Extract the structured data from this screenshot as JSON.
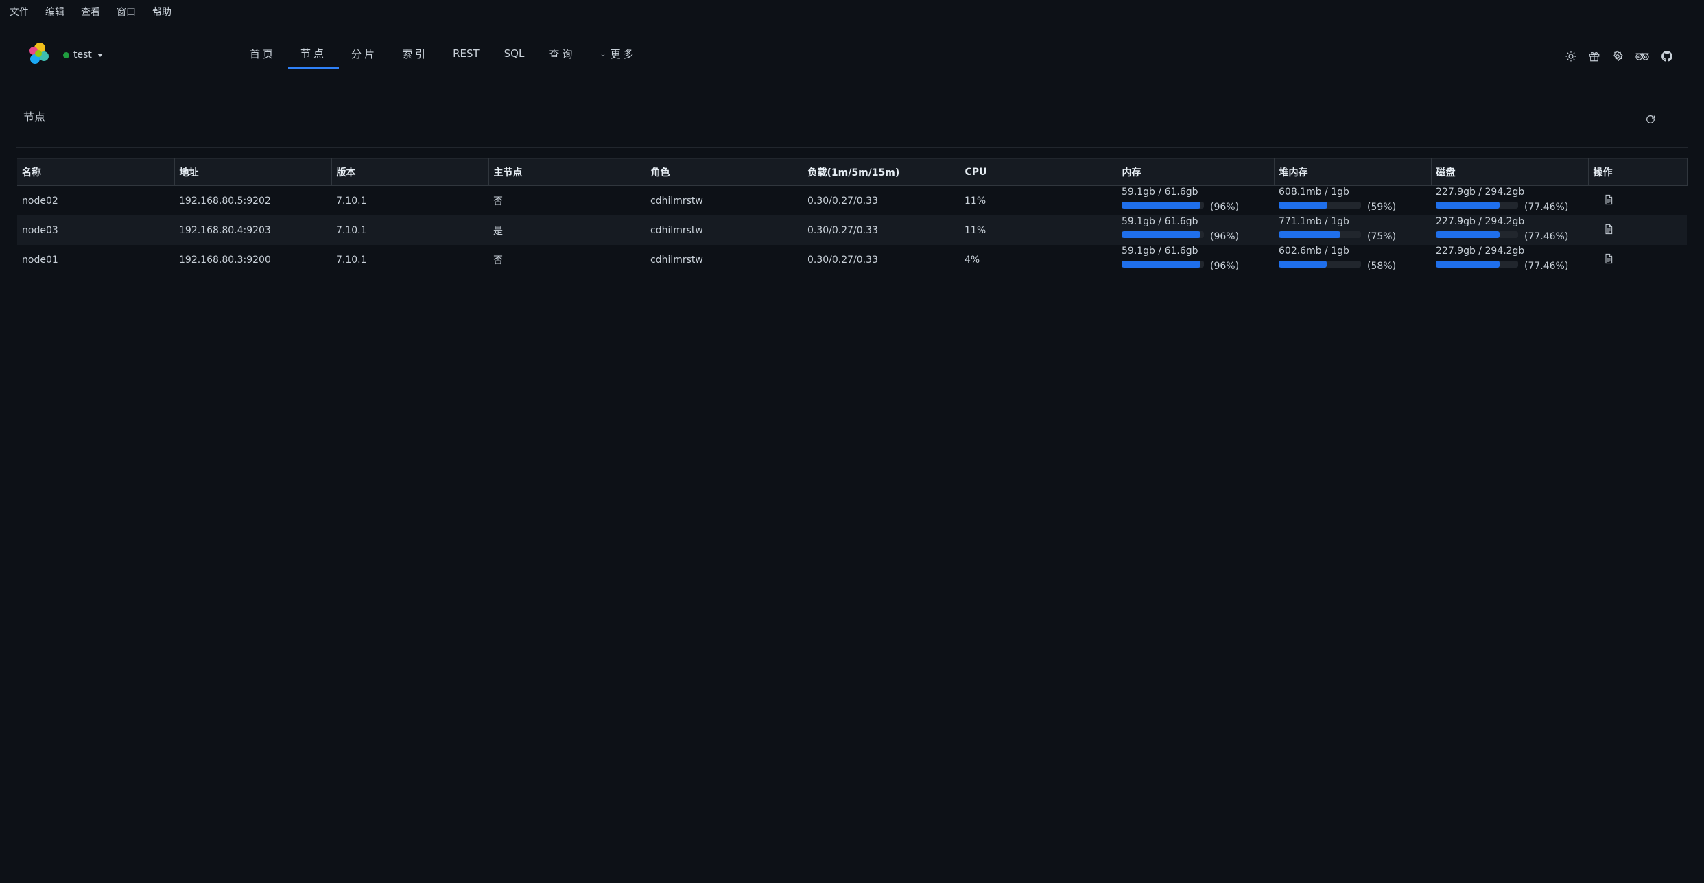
{
  "menubar": [
    "文件",
    "编辑",
    "查看",
    "窗口",
    "帮助"
  ],
  "header": {
    "cluster_name": "test",
    "cluster_status_color": "#1f9d3f",
    "tabs": [
      {
        "label": "首页",
        "active": false
      },
      {
        "label": "节点",
        "active": true
      },
      {
        "label": "分片",
        "active": false
      },
      {
        "label": "索引",
        "active": false
      },
      {
        "label": "REST",
        "active": false
      },
      {
        "label": "SQL",
        "active": false
      },
      {
        "label": "查询",
        "active": false
      },
      {
        "label": "更多",
        "active": false
      }
    ],
    "tools": [
      "sun-icon",
      "gift-icon",
      "settings-icon",
      "tripadvisor-icon",
      "github-icon"
    ]
  },
  "page": {
    "title": "节点"
  },
  "table": {
    "columns": [
      "名称",
      "地址",
      "版本",
      "主节点",
      "角色",
      "负载(1m/5m/15m)",
      "CPU",
      "内存",
      "堆内存",
      "磁盘",
      "操作"
    ],
    "rows": [
      {
        "name": "node02",
        "address": "192.168.80.5:9202",
        "version": "7.10.1",
        "master": "否",
        "roles": "cdhilmrstw",
        "load": "0.30/0.27/0.33",
        "cpu": "11%",
        "mem": {
          "text": "59.1gb / 61.6gb",
          "pct": "(96%)",
          "fraction": 0.96
        },
        "heap": {
          "text": "608.1mb / 1gb",
          "pct": "(59%)",
          "fraction": 0.59
        },
        "disk": {
          "text": "227.9gb / 294.2gb",
          "pct": "(77.46%)",
          "fraction": 0.7746
        }
      },
      {
        "name": "node03",
        "address": "192.168.80.4:9203",
        "version": "7.10.1",
        "master": "是",
        "roles": "cdhilmrstw",
        "load": "0.30/0.27/0.33",
        "cpu": "11%",
        "mem": {
          "text": "59.1gb / 61.6gb",
          "pct": "(96%)",
          "fraction": 0.96
        },
        "heap": {
          "text": "771.1mb / 1gb",
          "pct": "(75%)",
          "fraction": 0.75
        },
        "disk": {
          "text": "227.9gb / 294.2gb",
          "pct": "(77.46%)",
          "fraction": 0.7746
        }
      },
      {
        "name": "node01",
        "address": "192.168.80.3:9200",
        "version": "7.10.1",
        "master": "否",
        "roles": "cdhilmrstw",
        "load": "0.30/0.27/0.33",
        "cpu": "4%",
        "mem": {
          "text": "59.1gb / 61.6gb",
          "pct": "(96%)",
          "fraction": 0.96
        },
        "heap": {
          "text": "602.6mb / 1gb",
          "pct": "(58%)",
          "fraction": 0.58
        },
        "disk": {
          "text": "227.9gb / 294.2gb",
          "pct": "(77.46%)",
          "fraction": 0.7746
        }
      }
    ]
  },
  "colors": {
    "accent": "#1f6feb",
    "background": "#0d1117",
    "row_alt": "#161b22"
  }
}
